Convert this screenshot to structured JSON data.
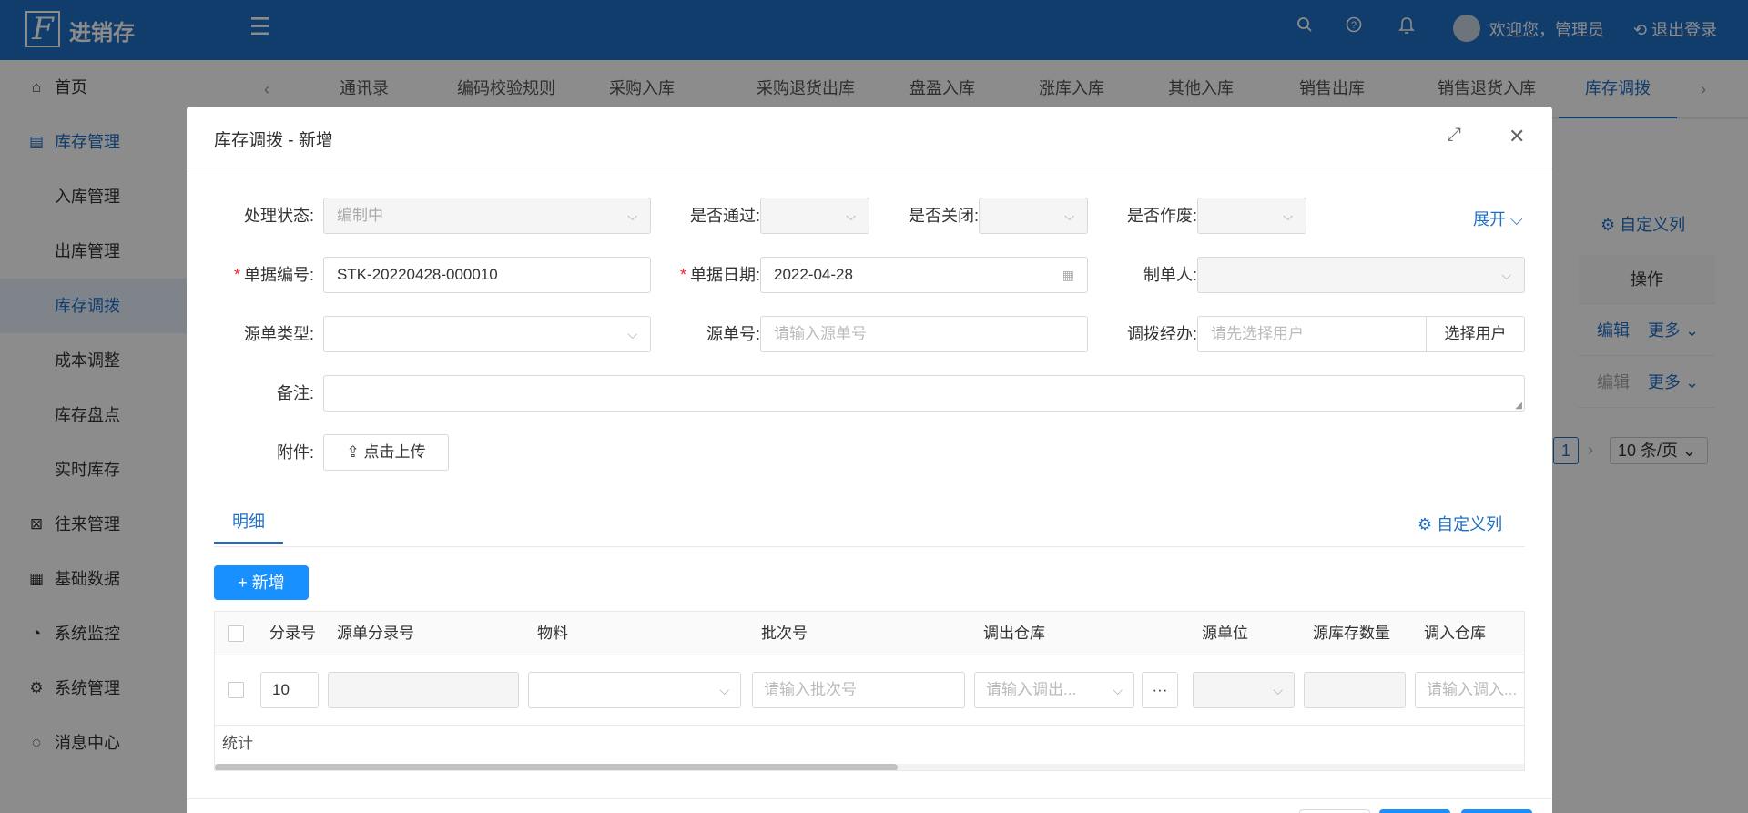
{
  "header": {
    "logo_letter": "F",
    "app_title": "进销存",
    "welcome": "欢迎您，管理员",
    "logout": "退出登录",
    "brand_color": "#1f6fc6"
  },
  "sidebar": {
    "items": [
      {
        "icon": "home-icon",
        "label": "首页"
      },
      {
        "icon": "inventory-icon",
        "label": "库存管理"
      },
      {
        "label": "入库管理"
      },
      {
        "label": "出库管理"
      },
      {
        "label": "库存调拨"
      },
      {
        "label": "成本调整"
      },
      {
        "label": "库存盘点"
      },
      {
        "label": "实时库存"
      },
      {
        "icon": "exchange-icon",
        "label": "往来管理"
      },
      {
        "icon": "grid-icon",
        "label": "基础数据"
      },
      {
        "icon": "monitor-icon",
        "label": "系统监控"
      },
      {
        "icon": "gear-icon",
        "label": "系统管理"
      },
      {
        "icon": "message-icon",
        "label": "消息中心"
      }
    ]
  },
  "tabs": [
    "通讯录",
    "编码校验规则",
    "采购入库",
    "采购退货出库",
    "盘盈入库",
    "涨库入库",
    "其他入库",
    "销售出库",
    "销售退货入库",
    "库存调拨"
  ],
  "background": {
    "custom_columns": "自定义列",
    "op_header": "操作",
    "edit": "编辑",
    "more": "更多",
    "page_num": "1",
    "page_size": "10 条/页"
  },
  "modal": {
    "title": "库存调拨 - 新增",
    "form": {
      "status_label": "处理状态:",
      "status_value": "编制中",
      "passed_label": "是否通过:",
      "closed_label": "是否关闭:",
      "void_label": "是否作废:",
      "expand": "展开",
      "doc_no_label": "单据编号:",
      "doc_no_value": "STK-20220428-000010",
      "doc_date_label": "单据日期:",
      "doc_date_value": "2022-04-28",
      "creator_label": "制单人:",
      "src_type_label": "源单类型:",
      "src_no_label": "源单号:",
      "src_no_placeholder": "请输入源单号",
      "handler_label": "调拨经办:",
      "handler_placeholder": "请先选择用户",
      "select_user": "选择用户",
      "remark_label": "备注:",
      "attach_label": "附件:",
      "upload": "点击上传"
    },
    "detail_tab": "明细",
    "custom_columns": "自定义列",
    "add_button": "新增",
    "grid": {
      "columns": [
        "分录号",
        "源单分录号",
        "物料",
        "批次号",
        "调出仓库",
        "源单位",
        "源库存数量",
        "调入仓库"
      ],
      "row": {
        "entry_no": "10",
        "batch_placeholder": "请输入批次号",
        "out_wh_placeholder": "请输入调出...",
        "in_wh_placeholder": "请输入调入..."
      },
      "summary": "统计"
    }
  }
}
